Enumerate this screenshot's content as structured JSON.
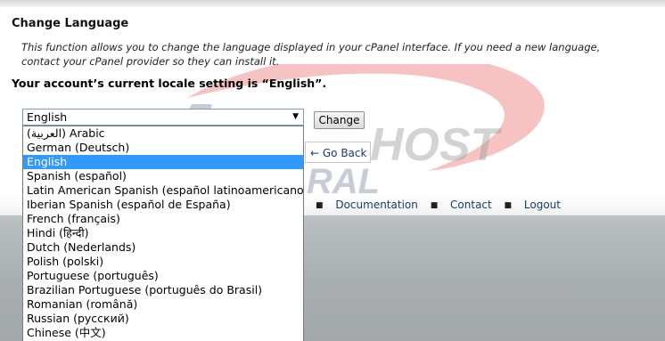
{
  "page": {
    "title": "Change Language",
    "description": "This function allows you to change the language displayed in your cPanel interface. If you need a new language, contact your cPanel provider so they can install it.",
    "locale_text": "Your account’s current locale setting is “English”."
  },
  "form": {
    "selected_value": "English",
    "change_button": "Change",
    "go_back": "← Go Back"
  },
  "language_options": [
    "(العربية) Arabic",
    "German (Deutsch)",
    "English",
    "Spanish (español)",
    "Latin American Spanish (español latinoamericano)",
    "Iberian Spanish (español de España)",
    "French (français)",
    "Hindi (हिन्दी)",
    "Dutch (Nederlands)",
    "Polish (polski)",
    "Portuguese (português)",
    "Brazilian Portuguese (português do Brasil)",
    "Romanian (română)",
    "Russian (русский)",
    "Chinese (中文)"
  ],
  "highlighted_option": "English",
  "footer": {
    "links": [
      "Documentation",
      "Contact",
      "Logout"
    ]
  },
  "watermark": {
    "text_main": "HOST",
    "text_sub": "ARAL"
  },
  "colors": {
    "highlight": "#3399ff",
    "link": "#1a3a6e",
    "logo_red": "#e85050",
    "logo_gray": "#9aa3b6"
  }
}
